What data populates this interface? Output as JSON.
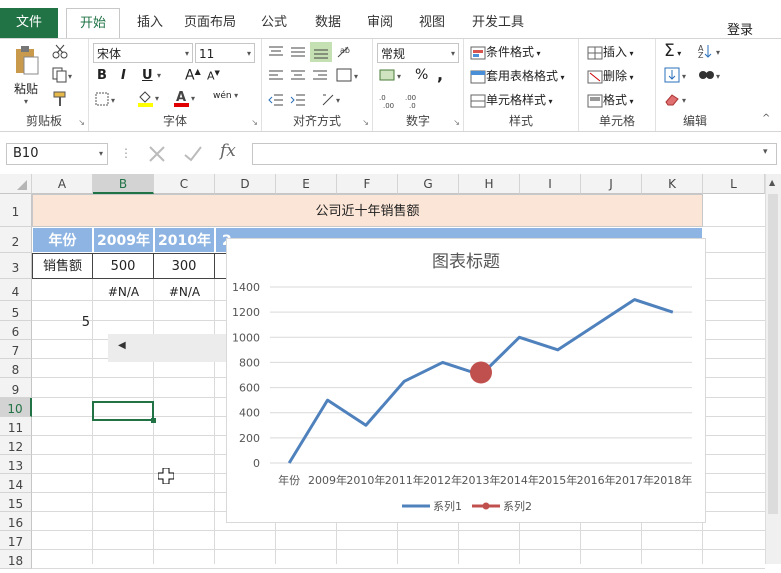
{
  "ribbon_tabs": {
    "file": "文件",
    "home": "开始",
    "insert": "插入",
    "layout": "页面布局",
    "formulas": "公式",
    "data": "数据",
    "review": "审阅",
    "view": "视图",
    "developer": "开发工具"
  },
  "login": "登录",
  "clipboard": {
    "paste": "粘贴",
    "label": "剪贴板"
  },
  "font": {
    "name": "宋体",
    "size": "11",
    "label": "字体",
    "bold": "B",
    "italic": "I",
    "underline": "U",
    "grow": "A",
    "shrink": "A",
    "phonetic": "wén"
  },
  "alignment": {
    "label": "对齐方式"
  },
  "number": {
    "format": "常规",
    "percent": "%",
    "comma": ",",
    "label": "数字"
  },
  "styles": {
    "conditional": "条件格式",
    "table": "套用表格格式",
    "cell": "单元格样式",
    "label": "样式"
  },
  "cells": {
    "insert": "插入",
    "delete": "删除",
    "format": "格式",
    "label": "单元格"
  },
  "editing": {
    "label": "编辑"
  },
  "formula_bar": {
    "name_box": "B10",
    "fx": "fx"
  },
  "columns": [
    "A",
    "B",
    "C",
    "D",
    "E",
    "F",
    "G",
    "H",
    "I",
    "J",
    "K",
    "L"
  ],
  "rows": [
    "1",
    "2",
    "3",
    "4",
    "5",
    "6",
    "7",
    "8",
    "9",
    "10",
    "11",
    "12",
    "13",
    "14",
    "15",
    "16",
    "17",
    "18"
  ],
  "sheet": {
    "title": "公司近十年销售额",
    "header_row": [
      "年份",
      "2009年",
      "2010年",
      "2"
    ],
    "sales_row": [
      "销售额",
      "500",
      "300",
      ""
    ],
    "na_row": [
      "",
      "#N/A",
      "#N/A",
      ""
    ],
    "a5": "5"
  },
  "colors": {
    "accent": "#217346",
    "header_fill": "#8db4e2",
    "title_fill": "#fbe5d6",
    "series1": "#4f81bd",
    "series2": "#c0504d"
  },
  "chart_data": {
    "type": "line",
    "title": "图表标题",
    "categories": [
      "年份",
      "2009年",
      "2010年",
      "2011年",
      "2012年",
      "2013年",
      "2014年",
      "2015年",
      "2016年",
      "2017年",
      "2018年"
    ],
    "series": [
      {
        "name": "系列1",
        "values": [
          0,
          500,
          300,
          650,
          800,
          700,
          1000,
          900,
          1100,
          1300,
          1200
        ]
      },
      {
        "name": "系列2",
        "values": [
          null,
          null,
          null,
          null,
          null,
          720,
          null,
          null,
          null,
          null,
          null
        ]
      }
    ],
    "ylim": [
      0,
      1400
    ],
    "yticks": [
      "0",
      "200",
      "400",
      "600",
      "800",
      "1000",
      "1200",
      "1400"
    ],
    "grid": true,
    "legend": "bottom"
  }
}
